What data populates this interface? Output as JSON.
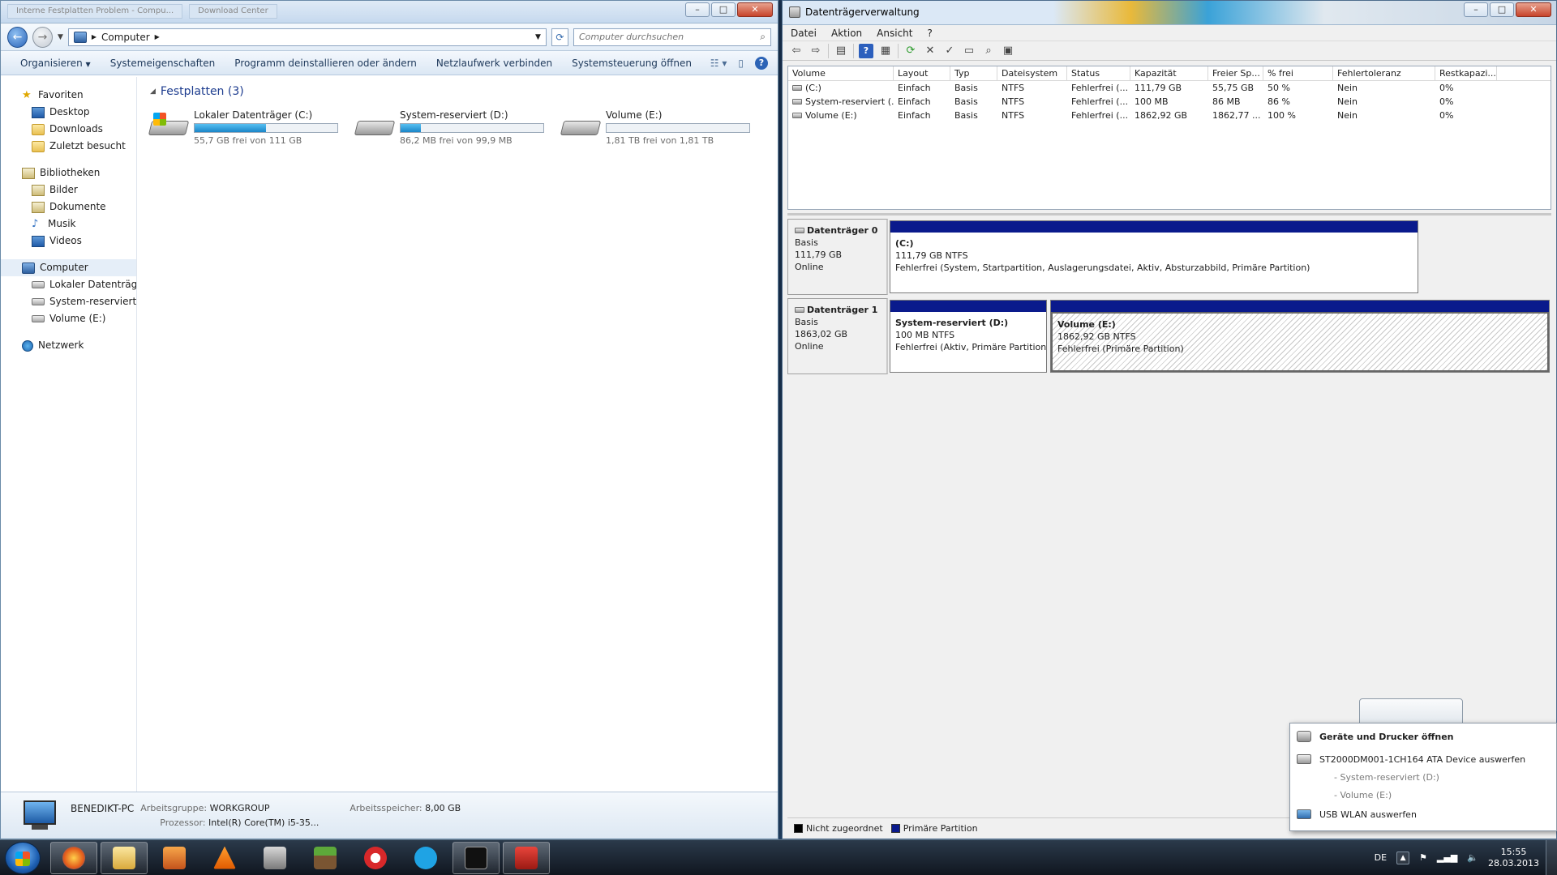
{
  "explorer": {
    "tab1": "Interne Festplatten Problem - Compu...",
    "tab2": "Download Center",
    "address": "Computer",
    "search_placeholder": "Computer durchsuchen",
    "commands": [
      "Organisieren",
      "Systemeigenschaften",
      "Programm deinstallieren oder ändern",
      "Netzlaufwerk verbinden",
      "Systemsteuerung öffnen"
    ],
    "nav": {
      "favorites": "Favoriten",
      "fav_items": [
        "Desktop",
        "Downloads",
        "Zuletzt besucht"
      ],
      "libraries": "Bibliotheken",
      "lib_items": [
        "Bilder",
        "Dokumente",
        "Musik",
        "Videos"
      ],
      "computer": "Computer",
      "comp_items": [
        "Lokaler Datenträger",
        "System-reserviert (D",
        "Volume (E:)"
      ],
      "network": "Netzwerk"
    },
    "group_title": "Festplatten (3)",
    "drives": [
      {
        "name": "Lokaler Datenträger (C:)",
        "free": "55,7 GB frei von 111 GB",
        "used_fraction": 0.5
      },
      {
        "name": "System-reserviert (D:)",
        "free": "86,2 MB frei von 99,9 MB",
        "used_fraction": 0.14
      },
      {
        "name": "Volume (E:)",
        "free": "1,81 TB frei von 1,81 TB",
        "used_fraction": 0.0
      }
    ],
    "details": {
      "pc_name": "BENEDIKT-PC",
      "workgroup_label": "Arbeitsgruppe:",
      "workgroup": "WORKGROUP",
      "memory_label": "Arbeitsspeicher:",
      "memory": "8,00 GB",
      "cpu_label": "Prozessor:",
      "cpu": "Intel(R) Core(TM) i5-35..."
    }
  },
  "diskmgmt": {
    "title": "Datenträgerverwaltung",
    "menu": [
      "Datei",
      "Aktion",
      "Ansicht",
      "?"
    ],
    "columns": [
      "Volume",
      "Layout",
      "Typ",
      "Dateisystem",
      "Status",
      "Kapazität",
      "Freier Sp...",
      "% frei",
      "Fehlertoleranz",
      "Restkapazi..."
    ],
    "rows": [
      [
        "(C:)",
        "Einfach",
        "Basis",
        "NTFS",
        "Fehlerfrei (...",
        "111,79 GB",
        "55,75 GB",
        "50 %",
        "Nein",
        "0%"
      ],
      [
        "System-reserviert (...",
        "Einfach",
        "Basis",
        "NTFS",
        "Fehlerfrei (...",
        "100 MB",
        "86 MB",
        "86 %",
        "Nein",
        "0%"
      ],
      [
        "Volume (E:)",
        "Einfach",
        "Basis",
        "NTFS",
        "Fehlerfrei (...",
        "1862,92 GB",
        "1862,77 ...",
        "100 %",
        "Nein",
        "0%"
      ]
    ],
    "disk0": {
      "name": "Datenträger 0",
      "type": "Basis",
      "size": "111,79 GB",
      "state": "Online",
      "partition": {
        "title": "(C:)",
        "size": "111,79 GB NTFS",
        "status": "Fehlerfrei (System, Startpartition, Auslagerungsdatei, Aktiv, Absturzabbild, Primäre Partition)"
      }
    },
    "disk1": {
      "name": "Datenträger 1",
      "type": "Basis",
      "size": "1863,02 GB",
      "state": "Online",
      "part_d": {
        "title": "System-reserviert  (D:)",
        "size": "100 MB NTFS",
        "status": "Fehlerfrei (Aktiv, Primäre Partition)"
      },
      "part_e": {
        "title": "Volume  (E:)",
        "size": "1862,92 GB NTFS",
        "status": "Fehlerfrei (Primäre Partition)"
      }
    },
    "legend": [
      "Nicht zugeordnet",
      "Primäre Partition"
    ],
    "colors": {
      "unallocated": "#000000",
      "primary": "#0a1a8c"
    }
  },
  "popup": {
    "devices": "Geräte und Drucker öffnen",
    "eject_disk": "ST2000DM001-1CH164 ATA Device auswerfen",
    "sub1": "-   System-reserviert (D:)",
    "sub2": "-   Volume (E:)",
    "eject_wlan": "USB WLAN auswerfen"
  },
  "taskbar": {
    "lang": "DE",
    "time": "15:55",
    "date": "28.03.2013",
    "apps": [
      "firefox-icon",
      "explorer-icon",
      "media-player-icon",
      "vlc-icon",
      "tool-icon",
      "minecraft-icon",
      "ccleaner-icon",
      "skype-icon",
      "cmd-icon",
      "toolbox-icon"
    ]
  }
}
